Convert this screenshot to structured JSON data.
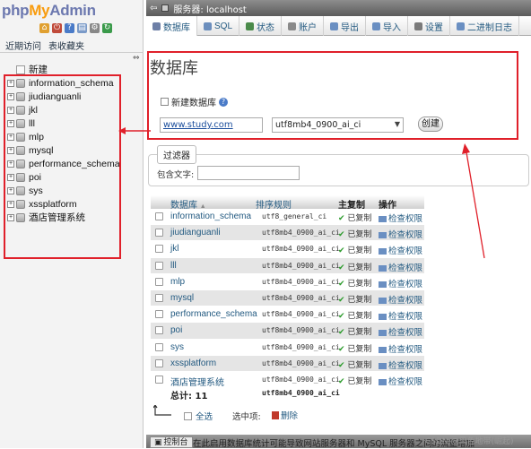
{
  "nav": {
    "logo": {
      "php": "php",
      "my": "My",
      "admin": "Admin"
    },
    "icons": [
      "home-icon",
      "logout-icon",
      "help-icon",
      "docs-icon",
      "settings-icon",
      "reload-icon"
    ],
    "tabs": [
      "近期访问",
      "表收藏夹"
    ],
    "new_label": "新建",
    "databases": [
      "information_schema",
      "jiudianguanli",
      "jkl",
      "lll",
      "mlp",
      "mysql",
      "performance_schema",
      "poi",
      "sys",
      "xssplatform",
      "酒店管理系统"
    ]
  },
  "server_bar": {
    "label": "服务器: localhost"
  },
  "tabs": [
    {
      "label": "数据库",
      "icon": "database-icon",
      "color": "#6d7fa6"
    },
    {
      "label": "SQL",
      "icon": "sql-icon",
      "color": "#6b8ebd"
    },
    {
      "label": "状态",
      "icon": "status-icon",
      "color": "#4a8a4a"
    },
    {
      "label": "账户",
      "icon": "users-icon",
      "color": "#8a8a8a"
    },
    {
      "label": "导出",
      "icon": "export-icon",
      "color": "#6a8fc2"
    },
    {
      "label": "导入",
      "icon": "import-icon",
      "color": "#6a8fc2"
    },
    {
      "label": "设置",
      "icon": "settings-icon",
      "color": "#7a7a7a"
    },
    {
      "label": "二进制日志",
      "icon": "binlog-icon",
      "color": "#6a8fc2"
    }
  ],
  "page": {
    "title": "数据库",
    "new_db_label": "新建数据库",
    "db_name_value": "www.study.com",
    "collation_value": "utf8mb4_0900_ai_ci",
    "create_button": "创建"
  },
  "filter": {
    "legend": "过滤器",
    "label": "包含文字:",
    "value": ""
  },
  "table": {
    "headers": {
      "name": "数据库",
      "sort_indicator": "▲",
      "collation": "排序规则",
      "replication": "主复制",
      "action": "操作"
    },
    "rows": [
      {
        "name": "information_schema",
        "collation": "utf8_general_ci",
        "replication": "已复制",
        "action": "检查权限"
      },
      {
        "name": "jiudianguanli",
        "collation": "utf8mb4_0900_ai_ci",
        "replication": "已复制",
        "action": "检查权限"
      },
      {
        "name": "jkl",
        "collation": "utf8mb4_0900_ai_ci",
        "replication": "已复制",
        "action": "检查权限"
      },
      {
        "name": "lll",
        "collation": "utf8mb4_0900_ai_ci",
        "replication": "已复制",
        "action": "检查权限"
      },
      {
        "name": "mlp",
        "collation": "utf8mb4_0900_ai_ci",
        "replication": "已复制",
        "action": "检查权限"
      },
      {
        "name": "mysql",
        "collation": "utf8mb4_0900_ai_ci",
        "replication": "已复制",
        "action": "检查权限"
      },
      {
        "name": "performance_schema",
        "collation": "utf8mb4_0900_ai_ci",
        "replication": "已复制",
        "action": "检查权限"
      },
      {
        "name": "poi",
        "collation": "utf8mb4_0900_ai_ci",
        "replication": "已复制",
        "action": "检查权限"
      },
      {
        "name": "sys",
        "collation": "utf8mb4_0900_ai_ci",
        "replication": "已复制",
        "action": "检查权限"
      },
      {
        "name": "xssplatform",
        "collation": "utf8mb4_0900_ai_ci",
        "replication": "已复制",
        "action": "检查权限"
      },
      {
        "name": "酒店管理系统",
        "collation": "utf8mb4_0900_ai_ci",
        "replication": "已复制",
        "action": "检查权限"
      }
    ],
    "total_label": "总计: 11",
    "total_collation": "utf8mb4_0900_ai_ci"
  },
  "bulk": {
    "select_all": "全选",
    "selected_label": "选中项:",
    "delete_label": "删除"
  },
  "console": {
    "tab_label": "控制台",
    "notice": "在此启用数据库统计可能导致网站服务器和 MySQL 服务器之间的流量增加"
  },
  "watermark": "CSDN @黑色地带(崛起)",
  "colors": {
    "annotation_red": "#e0202a",
    "link_blue": "#235a81",
    "ok_green": "#2a9a2a"
  }
}
